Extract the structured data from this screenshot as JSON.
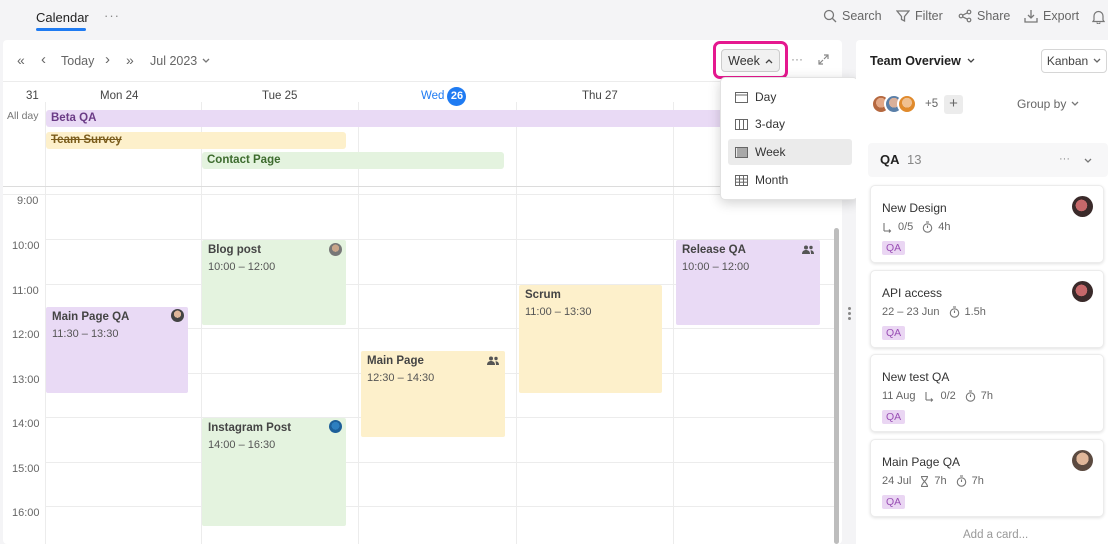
{
  "topbar": {
    "tab": "Calendar",
    "more": "···",
    "actions": {
      "search": "Search",
      "filter": "Filter",
      "share": "Share",
      "export": "Export"
    }
  },
  "calendar": {
    "nav": {
      "first": "«",
      "prev": "‹",
      "today": "Today",
      "next": "›",
      "last": "»"
    },
    "month_label": "Jul 2023",
    "view_button": "Week",
    "more": "···",
    "week_col": "31",
    "allday_label": "All day",
    "days": [
      {
        "dow": "Mon",
        "num": "24"
      },
      {
        "dow": "Tue",
        "num": "25"
      },
      {
        "dow": "Wed",
        "num": "26"
      },
      {
        "dow": "Thu",
        "num": "27"
      }
    ],
    "times": [
      "9:00",
      "10:00",
      "11:00",
      "12:00",
      "13:00",
      "14:00",
      "15:00",
      "16:00"
    ],
    "allday_events": [
      {
        "title": "Beta QA"
      },
      {
        "title": "Team Survey"
      },
      {
        "title": "Contact Page"
      }
    ],
    "events": [
      {
        "title": "Blog post",
        "time": "10:00 – 12:00"
      },
      {
        "title": "Release QA",
        "time": "10:00 – 12:00"
      },
      {
        "title": "Scrum",
        "time": "11:00 – 13:30"
      },
      {
        "title": "Main Page QA",
        "time": "11:30 – 13:30"
      },
      {
        "title": "Main Page",
        "time": "12:30 – 14:30"
      },
      {
        "title": "Instagram Post",
        "time": "14:00 – 16:30"
      }
    ]
  },
  "view_menu": {
    "items": [
      {
        "label": "Day",
        "icon": "day-view-icon"
      },
      {
        "label": "3-day",
        "icon": "three-day-view-icon"
      },
      {
        "label": "Week",
        "icon": "week-view-icon",
        "selected": true
      },
      {
        "label": "Month",
        "icon": "month-view-icon"
      }
    ]
  },
  "right_panel": {
    "title": "Team Overview",
    "view_select": "Kanban",
    "avatars_more": "+5",
    "add": "+",
    "group_by": "Group by",
    "group": {
      "name": "QA",
      "count": "13",
      "more": "···"
    },
    "cards": [
      {
        "title": "New Design",
        "subtasks": "0/5",
        "estimate": "4h",
        "tag": "QA"
      },
      {
        "title": "API access",
        "dates": "22 – 23 Jun",
        "estimate": "1.5h",
        "tag": "QA"
      },
      {
        "title": "New test QA",
        "dates": "11 Aug",
        "subtasks": "0/2",
        "estimate": "7h",
        "tag": "QA"
      },
      {
        "title": "Main Page QA",
        "dates": "24 Jul",
        "duration": "7h",
        "estimate": "7h",
        "tag": "QA"
      }
    ],
    "add_card": "Add a card..."
  },
  "colors": {
    "accent": "#1f7bf2",
    "highlight": "#e5188f",
    "event_purple": "#e9daf5",
    "event_green": "#e4f3df",
    "event_yellow": "#fdf0cb"
  }
}
